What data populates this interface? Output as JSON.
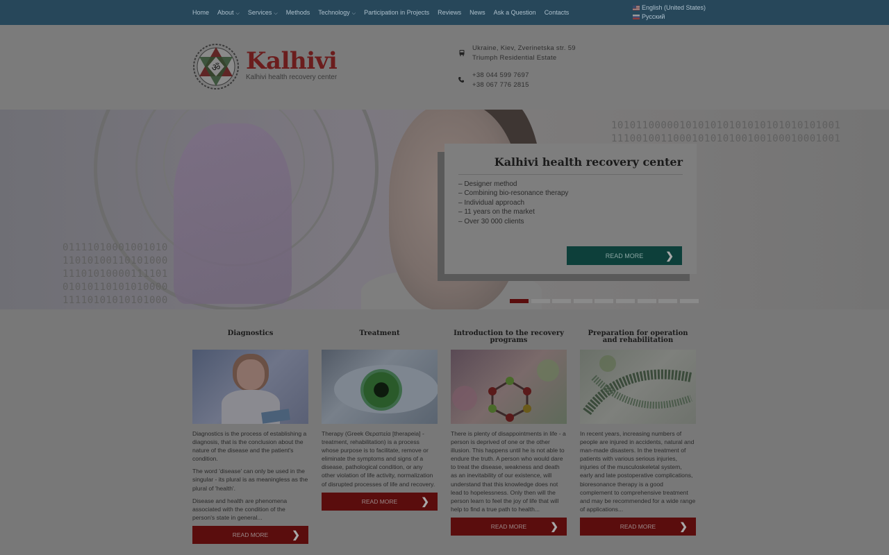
{
  "nav": {
    "items": [
      {
        "label": "Home",
        "caret": false
      },
      {
        "label": "About",
        "caret": true
      },
      {
        "label": "Services",
        "caret": true
      },
      {
        "label": "Methods",
        "caret": false
      },
      {
        "label": "Technology",
        "caret": true
      },
      {
        "label": "Participation in Projects",
        "caret": false
      },
      {
        "label": "Reviews",
        "caret": false
      },
      {
        "label": "News",
        "caret": false
      },
      {
        "label": "Ask a Question",
        "caret": false
      },
      {
        "label": "Contacts",
        "caret": false
      }
    ],
    "languages": [
      {
        "label": "English (United States)",
        "flag": "us-flag-icon"
      },
      {
        "label": "Русский",
        "flag": "ru-flag-icon"
      }
    ]
  },
  "header": {
    "brand": "Kalhivi",
    "tagline": "Kalhivi health recovery center",
    "address_line1": "Ukraine, Kiev, Zverinetska str. 59",
    "address_line2": "Triumph Residential Estate",
    "phone1": "+38 044 599 7697",
    "phone2": "+38 067 776 2815"
  },
  "slider": {
    "title": "Kalhivi health recovery center",
    "points": [
      "– Designer method",
      "– Combining bio-resonance therapy",
      "– Individual approach",
      "– 11 years on the market",
      "– Over 30 000 clients"
    ],
    "button": "READ MORE",
    "binary_right": "1010110000010101010101010101010101001\n1110010011000101010100100100010001001",
    "binary_left": "01111010001001010\n11010100110101000\n11101010000111101\n01010110101010000\n11110101010101000",
    "dot_count": 9,
    "active_dot": 0
  },
  "columns": [
    {
      "title": "Diagnostics",
      "paragraphs": [
        "Diagnostics is the process of establishing a diagnosis, that is the conclusion about the nature of the disease and the patient's condition.",
        "The word 'disease' can only be used in the singular - its plural is as meaningless as the plural of 'health'.",
        "Disease and health are phenomena associated with the condition of the person's state in general..."
      ],
      "button": "READ MORE"
    },
    {
      "title": "Treatment",
      "paragraphs": [
        "Therapy (Greek Θεραπεία [therapeia] - treatment, rehabilitation) is a process whose purpose is to facilitate, remove or eliminate the symptoms and signs of a disease, pathological condition, or any other violation of life activity, normalization of disrupted processes of life and recovery."
      ],
      "button": "READ MORE"
    },
    {
      "title": "Introduction to the recovery programs",
      "paragraphs": [
        "There is plenty of disappointments in life - a person is deprived of one or the other illusion. This happens until he is not able to endure the truth. A person who would dare to treat the disease, weakness and death as an inevitability of our existence, will understand that this knowledge does not lead to hopelessness. Only then will the person learn to feel the joy of life that will help to find a true path to health..."
      ],
      "button": "READ MORE"
    },
    {
      "title": "Preparation for operation and rehabilitation",
      "paragraphs": [
        "In recent years, increasing numbers of people are injured in accidents, natural and man-made disasters. In the treatment of patients with various serious injuries, injuries of the musculoskeletal system, early and late postoperative complications, bioresonance therapy is a good complement to comprehensive treatment and may be recommended for a wide range of applications..."
      ],
      "button": "READ MORE"
    }
  ]
}
